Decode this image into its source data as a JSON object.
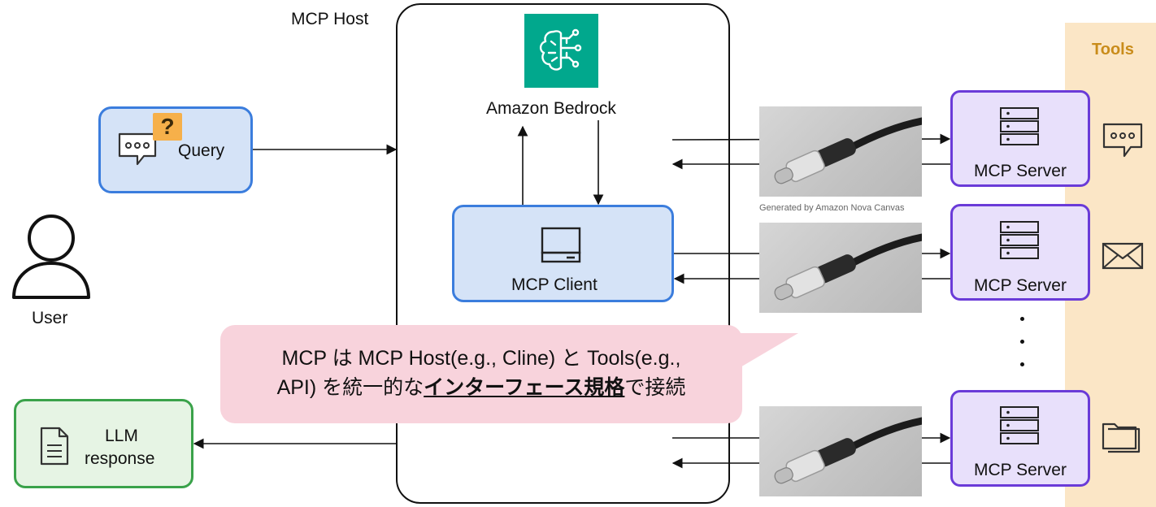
{
  "tools": {
    "label": "Tools"
  },
  "host": {
    "label": "MCP Host"
  },
  "bedrock": {
    "label": "Amazon Bedrock",
    "icon": "bedrock-brain-icon",
    "color": "#01a88d"
  },
  "query": {
    "label": "Query",
    "icons": [
      "chat-bubble-icon",
      "question-mark-icon"
    ]
  },
  "user": {
    "label": "User",
    "icon": "user-icon"
  },
  "client": {
    "label": "MCP Client",
    "icon": "computer-icon"
  },
  "llm": {
    "label_line1": "LLM",
    "label_line2": "response",
    "icon": "document-icon"
  },
  "servers": [
    {
      "label": "MCP Server",
      "tool_icon": "chat-icon"
    },
    {
      "label": "MCP Server",
      "tool_icon": "mail-icon"
    },
    {
      "label": "MCP Server",
      "tool_icon": "folder-icon"
    }
  ],
  "cable_caption": "Generated by Amazon Nova Canvas",
  "callout": {
    "line1": "MCP は MCP Host(e.g., Cline) と Tools(e.g.,",
    "line2_prefix": "API) を統一的な",
    "line2_emphasis": "インターフェース規格",
    "line2_suffix": "で接続"
  },
  "colors": {
    "blue_border": "#3b7ddd",
    "blue_fill": "#d5e3f7",
    "green_border": "#3aa24a",
    "green_fill": "#e6f4e4",
    "purple_border": "#6a3bd8",
    "purple_fill": "#e8e0fb",
    "tools_band": "#fbe6c6",
    "tools_text": "#c98c1a",
    "callout_fill": "#f8d3dc"
  }
}
